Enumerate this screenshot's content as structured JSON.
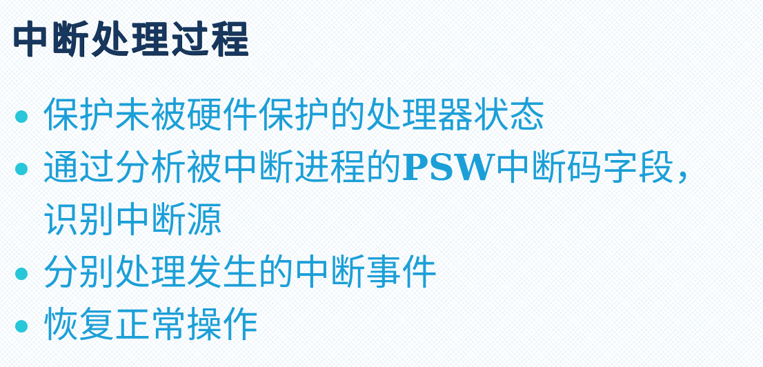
{
  "slide": {
    "title": "中断处理过程",
    "bullets": [
      {
        "text": "保护未被硬件保护的处理器状态"
      },
      {
        "text_part1": "通过分析被中断进程的",
        "text_latin": "PSW",
        "text_part2": "中断码字段，识别中断源"
      },
      {
        "text": "分别处理发生的中断事件"
      },
      {
        "text": "恢复正常操作"
      }
    ]
  },
  "colors": {
    "title": "#17375e",
    "bullet_text": "#1c9fd7",
    "bullet_dot": "#27c6d8"
  }
}
